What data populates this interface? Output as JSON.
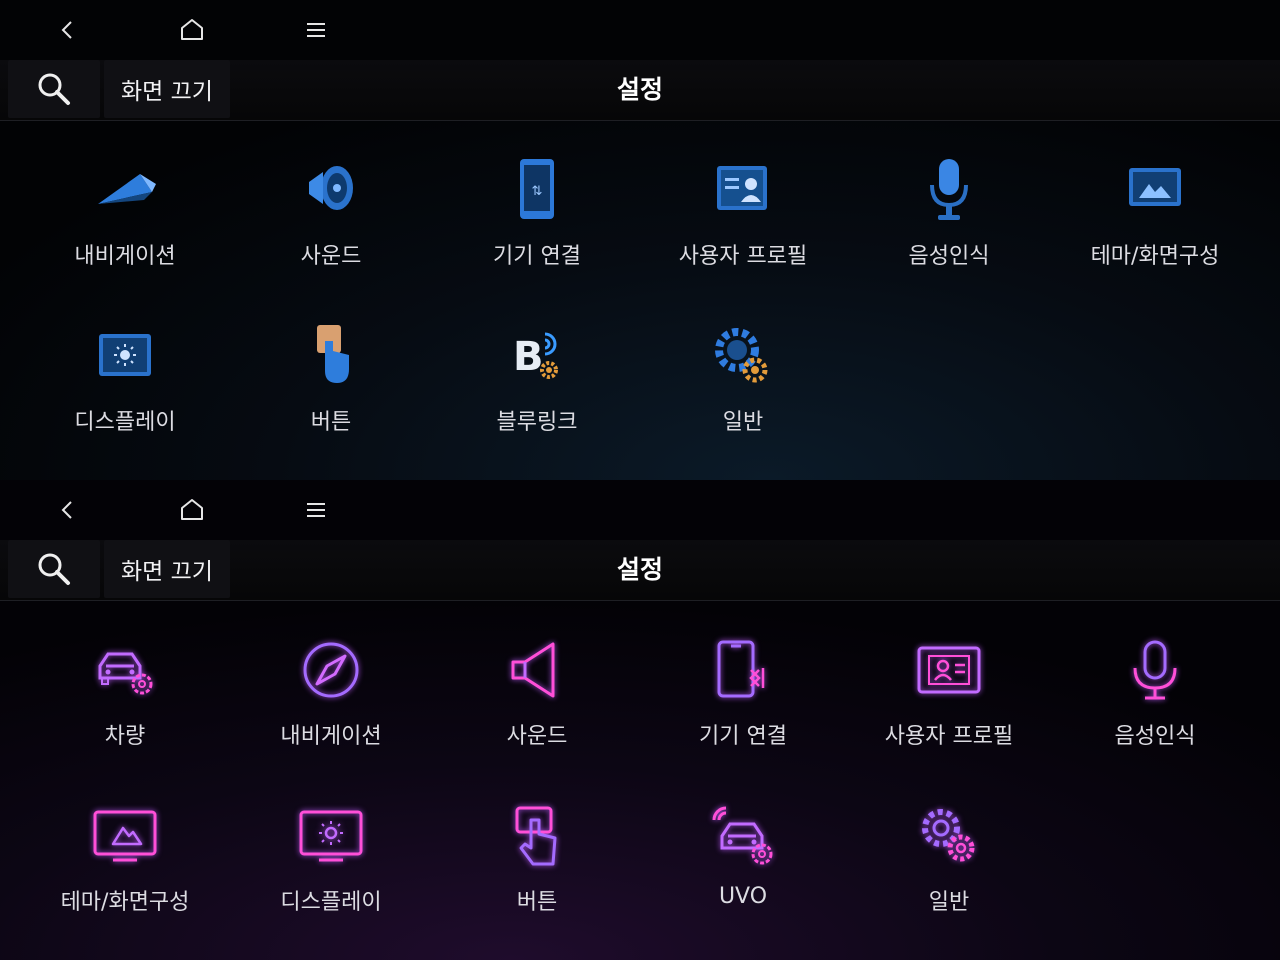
{
  "screens": [
    {
      "theme": "blue",
      "nav": {
        "back_icon": "chevron-left-icon",
        "home_icon": "home-icon",
        "menu_icon": "menu-icon"
      },
      "header": {
        "search_icon": "search-icon",
        "screen_off_label": "화면 끄기",
        "title": "설정"
      },
      "items": [
        {
          "label": "내비게이션",
          "icon": "navigation-icon"
        },
        {
          "label": "사운드",
          "icon": "speaker-icon"
        },
        {
          "label": "기기 연결",
          "icon": "phone-connection-icon"
        },
        {
          "label": "사용자 프로필",
          "icon": "profile-card-icon"
        },
        {
          "label": "음성인식",
          "icon": "microphone-icon"
        },
        {
          "label": "테마/화면구성",
          "icon": "theme-monitor-icon"
        },
        {
          "label": "디스플레이",
          "icon": "display-brightness-icon"
        },
        {
          "label": "버튼",
          "icon": "button-touch-icon"
        },
        {
          "label": "블루링크",
          "icon": "bluelink-icon"
        },
        {
          "label": "일반",
          "icon": "gear-icon"
        }
      ]
    },
    {
      "theme": "purple",
      "nav": {
        "back_icon": "chevron-left-icon",
        "home_icon": "home-icon",
        "menu_icon": "menu-icon"
      },
      "header": {
        "search_icon": "search-icon",
        "screen_off_label": "화면 끄기",
        "title": "설정"
      },
      "items": [
        {
          "label": "차량",
          "icon": "vehicle-settings-icon"
        },
        {
          "label": "내비게이션",
          "icon": "compass-icon"
        },
        {
          "label": "사운드",
          "icon": "speaker-icon"
        },
        {
          "label": "기기 연결",
          "icon": "phone-connection-icon"
        },
        {
          "label": "사용자 프로필",
          "icon": "profile-card-icon"
        },
        {
          "label": "음성인식",
          "icon": "microphone-icon"
        },
        {
          "label": "테마/화면구성",
          "icon": "theme-monitor-icon"
        },
        {
          "label": "디스플레이",
          "icon": "display-brightness-icon"
        },
        {
          "label": "버튼",
          "icon": "button-touch-icon"
        },
        {
          "label": "UVO",
          "icon": "uvo-connected-car-icon"
        },
        {
          "label": "일반",
          "icon": "gear-icon"
        }
      ]
    }
  ],
  "colors": {
    "neon_violet": "#b34dff",
    "neon_pink": "#ff4fd8",
    "blue_accent": "#2f7ce0"
  }
}
